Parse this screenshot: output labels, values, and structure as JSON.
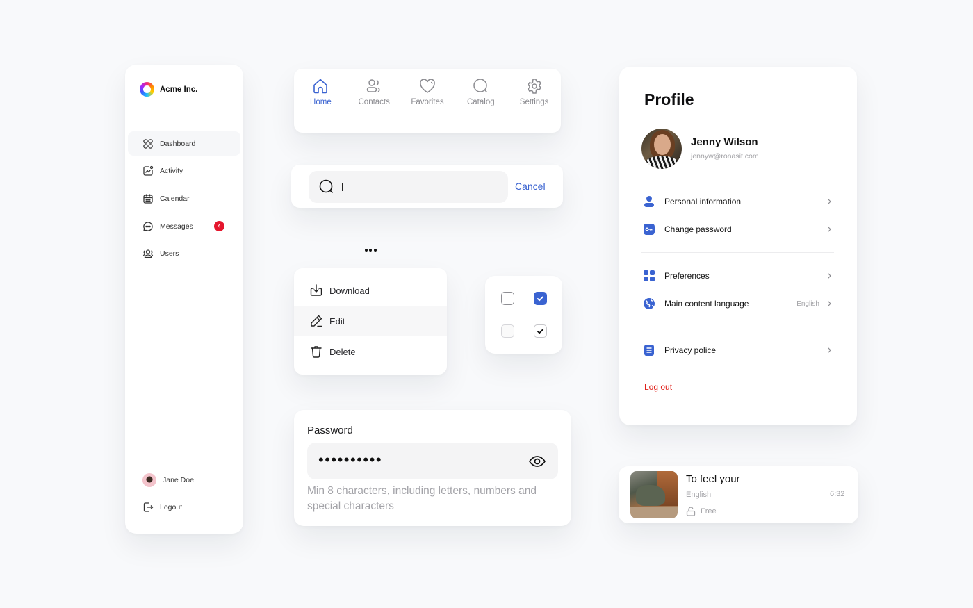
{
  "sidebar": {
    "brand": "Acme Inc.",
    "items": [
      {
        "label": "Dashboard",
        "icon": "grid-icon",
        "active": true
      },
      {
        "label": "Activity",
        "icon": "activity-chart-icon"
      },
      {
        "label": "Calendar",
        "icon": "calendar-icon"
      },
      {
        "label": "Messages",
        "icon": "chat-bubble-icon",
        "badge": "4"
      },
      {
        "label": "Users",
        "icon": "users-icon"
      }
    ],
    "user": {
      "name": "Jane Doe"
    },
    "logout_label": "Logout"
  },
  "tabbar": {
    "tabs": [
      {
        "label": "Home",
        "icon": "home-icon",
        "active": true
      },
      {
        "label": "Contacts",
        "icon": "contacts-icon"
      },
      {
        "label": "Favorites",
        "icon": "heart-icon"
      },
      {
        "label": "Catalog",
        "icon": "search-icon"
      },
      {
        "label": "Settings",
        "icon": "gear-icon"
      }
    ],
    "active_color": "#3a63d1",
    "inactive_color": "#8a8a8f"
  },
  "search": {
    "value": "",
    "placeholder": "",
    "cancel_label": "Cancel"
  },
  "context_menu": {
    "trigger_icon": "more-horizontal-icon",
    "items": [
      {
        "label": "Download",
        "icon": "download-icon"
      },
      {
        "label": "Edit",
        "icon": "pencil-icon",
        "hovered": true
      },
      {
        "label": "Delete",
        "icon": "trash-icon"
      }
    ]
  },
  "checkboxes": {
    "items": [
      {
        "state": "unchecked",
        "variant": "default"
      },
      {
        "state": "checked",
        "variant": "filled"
      },
      {
        "state": "unchecked",
        "variant": "disabled"
      },
      {
        "state": "checked",
        "variant": "outline"
      }
    ],
    "accent": "#3a63d1"
  },
  "password": {
    "label": "Password",
    "masked_value": "••••••••••",
    "hint": "Min 8 characters, including letters, numbers and special characters",
    "toggle_icon": "eye-icon"
  },
  "profile": {
    "title": "Profile",
    "name": "Jenny Wilson",
    "email": "jennyw@ronasit.com",
    "groups": [
      [
        {
          "label": "Personal information",
          "icon": "person-icon"
        },
        {
          "label": "Change password",
          "icon": "key-icon"
        }
      ],
      [
        {
          "label": "Preferences",
          "icon": "grid-icon"
        },
        {
          "label": "Main content language",
          "icon": "globe-icon",
          "value": "English"
        }
      ],
      [
        {
          "label": "Privacy police",
          "icon": "document-icon"
        }
      ]
    ],
    "logout_label": "Log out",
    "accent": "#3a63d1",
    "danger": "#e0211b"
  },
  "media": {
    "title": "To feel your",
    "language": "English",
    "access": "Free",
    "duration": "6:32"
  }
}
